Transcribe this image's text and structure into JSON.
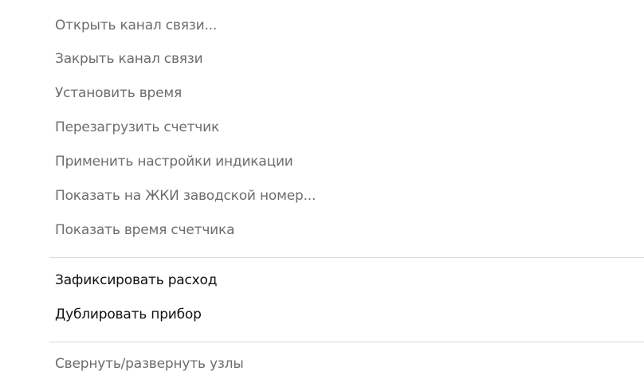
{
  "menu": {
    "group1": [
      {
        "label": "Открыть канал связи...",
        "enabled": false
      },
      {
        "label": "Закрыть канал связи",
        "enabled": false
      },
      {
        "label": "Установить время",
        "enabled": false
      },
      {
        "label": "Перезагрузить счетчик",
        "enabled": false
      },
      {
        "label": "Применить настройки индикации",
        "enabled": false
      },
      {
        "label": "Показать на ЖКИ заводской номер...",
        "enabled": false
      },
      {
        "label": "Показать время счетчика",
        "enabled": false
      }
    ],
    "group2": [
      {
        "label": "Зафиксировать расход",
        "enabled": true
      },
      {
        "label": "Дублировать прибор",
        "enabled": true
      }
    ],
    "group3": [
      {
        "label": "Свернуть/развернуть узлы",
        "enabled": false
      }
    ]
  }
}
